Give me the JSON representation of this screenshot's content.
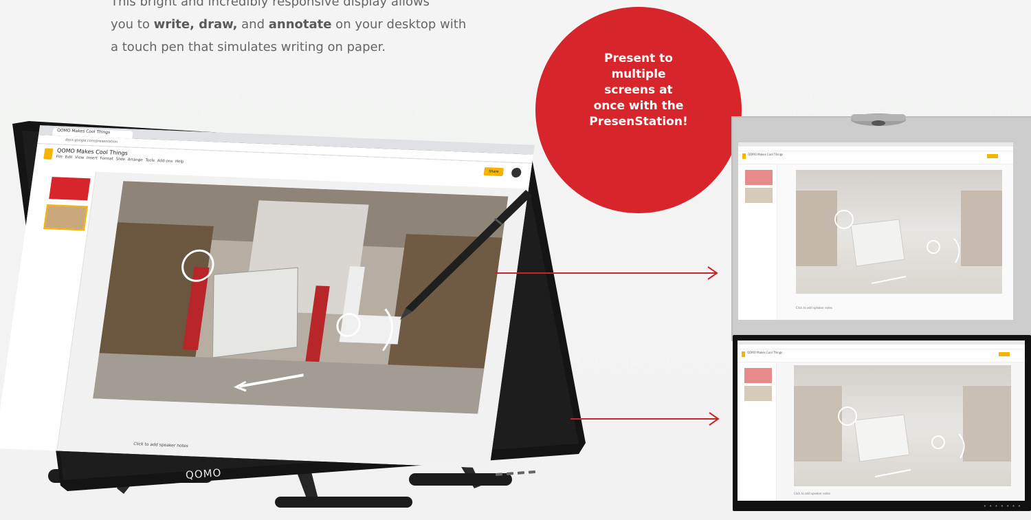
{
  "intro": {
    "line1": "This bright and incredibly responsive display allows",
    "line2_prefix": "you to ",
    "line2_bold1": "write, draw,",
    "line2_mid": " and ",
    "line2_bold2": "annotate",
    "line2_suffix": " on your desktop with",
    "line3": "a touch pen that simulates writing on paper."
  },
  "badge": {
    "text": "Present to multiple screens at once with the PresenStation!",
    "color": "#d7262b"
  },
  "tablet": {
    "brand": "QOMO",
    "browser_tab": "QOMO Makes Cool Things",
    "doc_title": "QOMO Makes Cool Things",
    "menu": "File Edit View Insert Format Slide Arrange Tools Add-ons Help",
    "share_label": "Share",
    "notes_placeholder": "Click to add speaker notes"
  },
  "projector": {
    "doc_title": "QOMO Makes Cool Things",
    "notes_placeholder": "Click to add speaker notes"
  },
  "tv": {
    "doc_title": "QOMO Makes Cool Things",
    "notes_placeholder": "Click to add speaker notes"
  },
  "colors": {
    "accent": "#d7262b",
    "arrow": "#c8242a",
    "share": "#f4b400"
  },
  "icons": [
    "pen-stylus-icon",
    "camera-icon",
    "arrow-right-icon",
    "slides-logo-icon"
  ]
}
